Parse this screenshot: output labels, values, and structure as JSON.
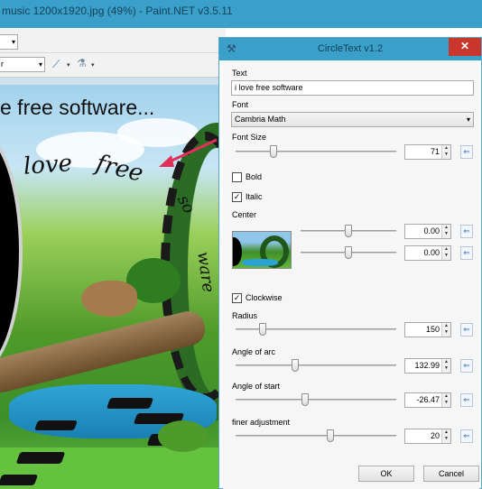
{
  "window": {
    "title": "music 1200x1920.jpg (49%) - Paint.NET v3.5.11"
  },
  "toolbar": {
    "select_top_value": "",
    "select_second_value": "r"
  },
  "canvas": {
    "top_text": "e free software...",
    "arc_words": [
      "love",
      "free",
      "so",
      "ware"
    ]
  },
  "dialog": {
    "title": "CircleText v1.2",
    "close_glyph": "✕",
    "text_label": "Text",
    "text_value": "i love free software",
    "font_label": "Font",
    "font_value": "Cambria Math",
    "font_size_label": "Font Size",
    "font_size_value": "71",
    "bold_label": "Bold",
    "bold_checked": false,
    "italic_label": "Italic",
    "italic_checked": true,
    "center_label": "Center",
    "center_x_value": "0.00",
    "center_y_value": "0.00",
    "clockwise_label": "Clockwise",
    "clockwise_checked": true,
    "radius_label": "Radius",
    "radius_value": "150",
    "angle_arc_label": "Angle of arc",
    "angle_arc_value": "132.99",
    "angle_start_label": "Angle of start",
    "angle_start_value": "-26.47",
    "finer_label": "finer adjustment",
    "finer_value": "20",
    "ok_label": "OK",
    "cancel_label": "Cancel",
    "check_glyph": "✓",
    "reset_glyph": "⇐"
  },
  "colors": {
    "titlebar": "#3aa0c9",
    "close": "#c8362c",
    "arrow": "#e0305a"
  }
}
